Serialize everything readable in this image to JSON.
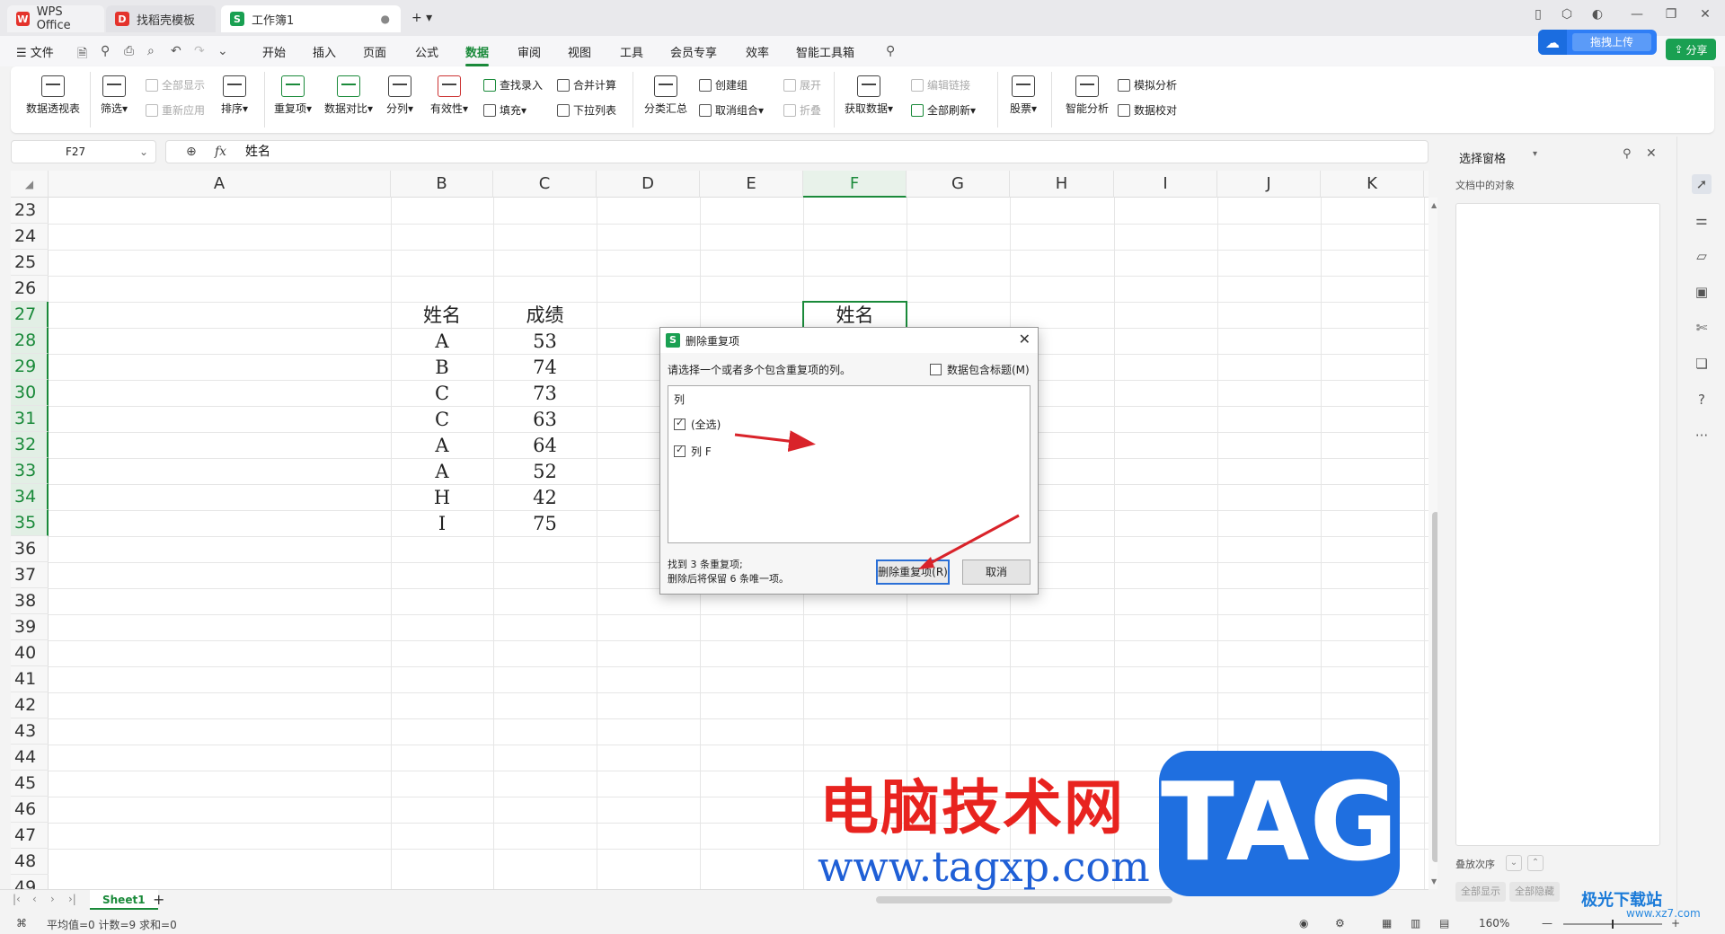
{
  "titlebar": {
    "tabs": [
      {
        "label": "WPS Office",
        "icon": "wps-logo-icon"
      },
      {
        "label": "找稻壳模板",
        "icon": "docer-icon"
      },
      {
        "label": "工作簿1",
        "icon": "sheet-icon"
      }
    ],
    "new_tab": "+ ▾"
  },
  "menubar": {
    "file": "☰ 文件",
    "items": [
      "开始",
      "插入",
      "页面",
      "公式",
      "数据",
      "审阅",
      "视图",
      "工具",
      "会员专享",
      "效率",
      "智能工具箱"
    ],
    "active": "数据",
    "upload": "拖拽上传",
    "share": "分享"
  },
  "ribbon": {
    "pivot": "数据透视表",
    "filter": "筛选",
    "show_all": "全部显示",
    "reapply": "重新应用",
    "sort": "排序",
    "duplicates": "重复项",
    "compare": "数据对比",
    "split": "分列",
    "validity": "有效性",
    "lookup": "查找录入",
    "fill": "填充",
    "consolidate": "合并计算",
    "dropdown": "下拉列表",
    "subtotal": "分类汇总",
    "group": "创建组",
    "ungroup": "取消组合",
    "expand": "展开",
    "collapse": "折叠",
    "get_data": "获取数据",
    "edit_links": "编辑链接",
    "refresh_all": "全部刷新",
    "stocks": "股票",
    "smart": "智能分析",
    "whatif": "模拟分析",
    "verify": "数据校对"
  },
  "formula_bar": {
    "name_box": "F27",
    "fx": "fx",
    "value": "姓名"
  },
  "columns": [
    "A",
    "B",
    "C",
    "D",
    "E",
    "F",
    "G",
    "H",
    "I",
    "J",
    "K"
  ],
  "selected_column": "F",
  "rows": [
    "23",
    "24",
    "25",
    "26",
    "27",
    "28",
    "29",
    "30",
    "31",
    "32",
    "33",
    "34",
    "35",
    "36",
    "37",
    "38",
    "39",
    "40",
    "41",
    "42",
    "43",
    "44",
    "45",
    "46",
    "47",
    "48",
    "49"
  ],
  "table": {
    "headers": [
      "姓名",
      "成绩"
    ],
    "names": [
      "A",
      "B",
      "C",
      "C",
      "A",
      "A",
      "H",
      "I"
    ],
    "scores": [
      "53",
      "74",
      "73",
      "63",
      "64",
      "52",
      "42",
      "75"
    ]
  },
  "f27_value": "姓名",
  "sheet_tabs": {
    "sheet": "Sheet1",
    "add": "+"
  },
  "status": {
    "stats": "平均值=0  计数=9  求和=0",
    "zoom": "160%"
  },
  "right_pane": {
    "title": "选择窗格",
    "subtitle": "文档中的对象",
    "order": "叠放次序",
    "show_all": "全部显示",
    "hide_all": "全部隐藏"
  },
  "dialog": {
    "title": "删除重复项",
    "prompt": "请选择一个或者多个包含重复项的列。",
    "has_header": "数据包含标题(M)",
    "list_header": "列",
    "items": [
      "(全选)",
      "列 F"
    ],
    "info_line1": "找到 3 条重复项;",
    "info_line2": "删除后将保留 6 条唯一项。",
    "ok": "删除重复项(R)",
    "cancel": "取消"
  },
  "watermark": {
    "cn": "电脑技术网",
    "url": "www.tagxp.com",
    "tag": "TAG",
    "jg": "极光下载站",
    "jg_url": "www.xz7.com"
  },
  "colors": {
    "accent": "#1a8a3a",
    "upload": "#2f7ef6",
    "arrow": "#d9232a"
  }
}
